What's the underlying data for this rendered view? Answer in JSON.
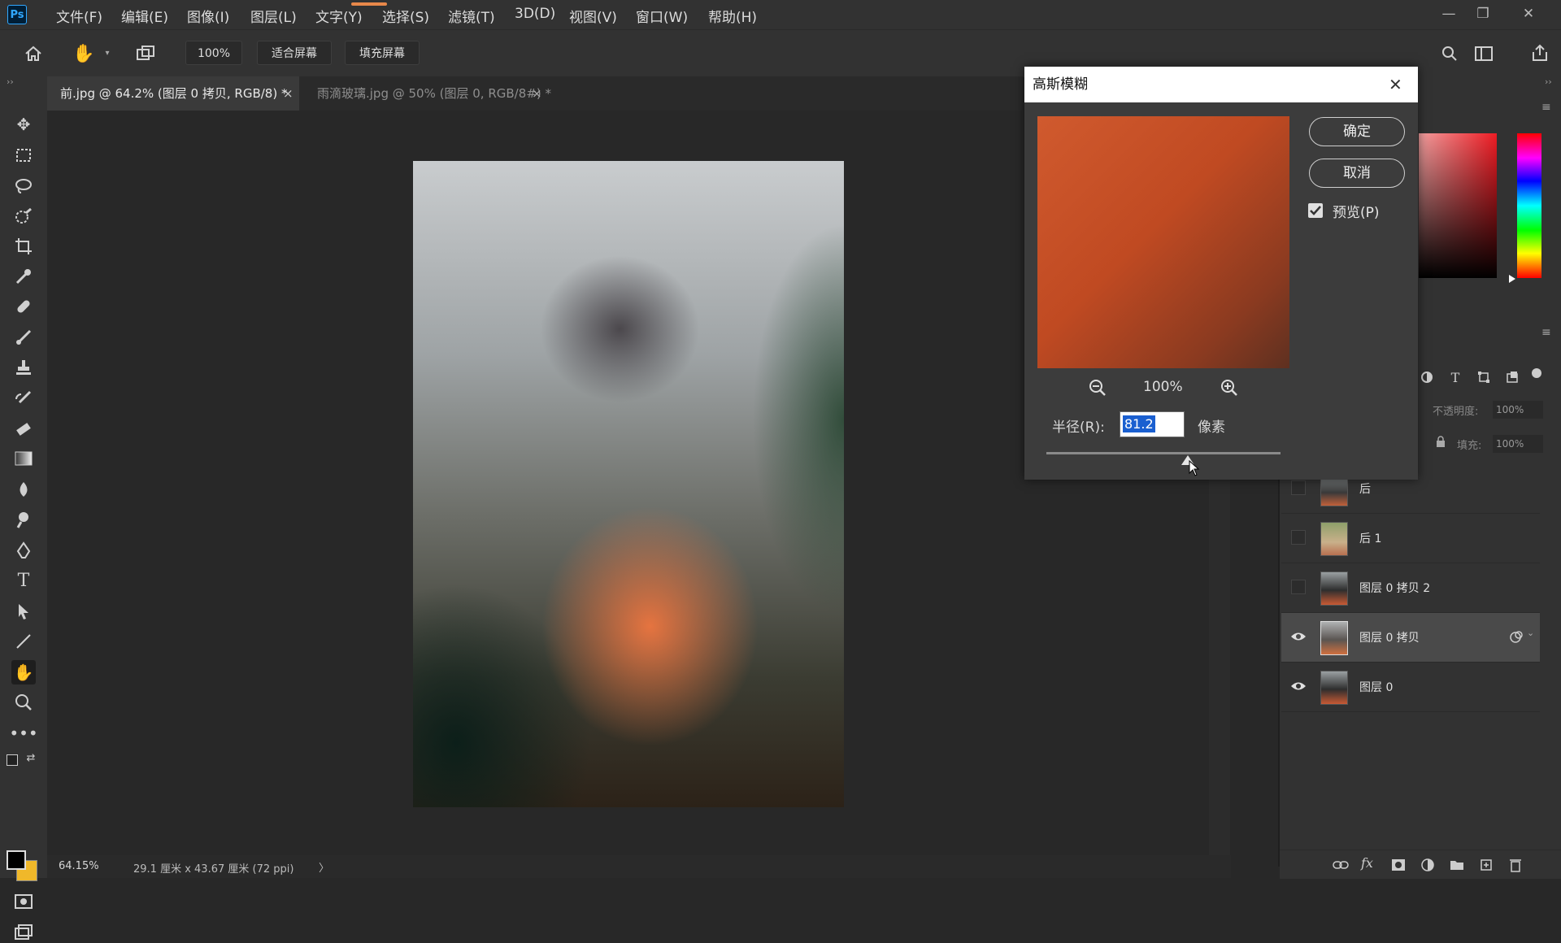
{
  "menubar": {
    "logo": "Ps",
    "items": [
      "文件(F)",
      "编辑(E)",
      "图像(I)",
      "图层(L)",
      "文字(Y)",
      "选择(S)",
      "滤镜(T)",
      "3D(D)",
      "视图(V)",
      "窗口(W)",
      "帮助(H)"
    ],
    "window_buttons": {
      "minimize": "—",
      "restore": "❐",
      "close": "✕"
    }
  },
  "options": {
    "zoom": "100%",
    "fit_screen": "适合屏幕",
    "fill_screen": "填充屏幕"
  },
  "tabs": [
    {
      "label": "前.jpg @ 64.2% (图层 0 拷贝, RGB/8) *",
      "close": "×"
    },
    {
      "label": "雨滴玻璃.jpg @ 50% (图层 0, RGB/8#) *",
      "close": "×"
    }
  ],
  "status": {
    "zoom": "64.15%",
    "doc_size": "29.1 厘米 x 43.67 厘米 (72 ppi)",
    "arrow": "〉"
  },
  "dialog": {
    "title": "高斯模糊",
    "ok": "确定",
    "cancel": "取消",
    "preview_label": "预览(P)",
    "preview_checked": true,
    "zoom_level": "100%",
    "radius_label": "半径(R):",
    "radius_value": "81.2",
    "unit": "像素",
    "close": "✕"
  },
  "layers_panel": {
    "opacity_label": "不透明度:",
    "opacity_value": "100%",
    "fill_label": "填充:",
    "fill_value": "100%",
    "layers": [
      {
        "name": "后",
        "visible": false,
        "selected": false
      },
      {
        "name": "后 1",
        "visible": false,
        "selected": false
      },
      {
        "name": "图层 0 拷贝 2",
        "visible": false,
        "selected": false
      },
      {
        "name": "图层 0 拷贝",
        "visible": true,
        "selected": true
      },
      {
        "name": "图层 0",
        "visible": true,
        "selected": false
      }
    ]
  },
  "colors": {
    "accent": "#31a8ff",
    "selection": "#1a5fd0",
    "dialog_bg": "#3c3c3c"
  }
}
